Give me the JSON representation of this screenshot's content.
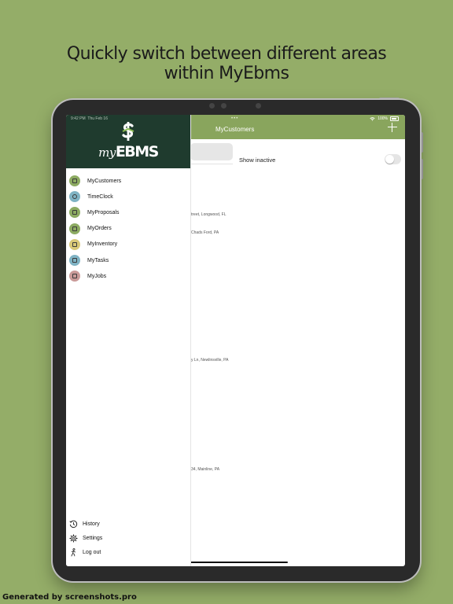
{
  "headline": {
    "line1": "Quickly switch between different areas",
    "line2": "within MyEbms"
  },
  "footer_credit": "Generated by screenshots.pro",
  "status_bar": {
    "time": "9:42 PM",
    "date": "Thu Feb 16",
    "battery": "100%"
  },
  "nav": {
    "dots": "•••",
    "title": "MyCustomers",
    "add_icon": "plus-icon"
  },
  "filter": {
    "show_inactive_label": "Show inactive",
    "show_inactive_on": false
  },
  "customer_addresses": [
    "treet, Longwood, FL",
    "Chads Ford, PA",
    "y Ln, Newlinsville, PA",
    "34, Mainline, PA"
  ],
  "brand": {
    "logo_my": "my",
    "logo_ebms": "EBMS",
    "sidebar_header_color": "#1f3b2e",
    "nav_color": "#89a55d"
  },
  "menu": [
    {
      "label": "MyCustomers",
      "icon": "customers-icon",
      "color": "#8dab62"
    },
    {
      "label": "TimeClock",
      "icon": "clock-icon",
      "color": "#7fb3c4"
    },
    {
      "label": "MyProposals",
      "icon": "proposal-icon",
      "color": "#8dab62"
    },
    {
      "label": "MyOrders",
      "icon": "orders-icon",
      "color": "#8dab62"
    },
    {
      "label": "MyInventory",
      "icon": "inventory-icon",
      "color": "#d9c878"
    },
    {
      "label": "MyTasks",
      "icon": "tasks-icon",
      "color": "#7fb3c4"
    },
    {
      "label": "MyJobs",
      "icon": "jobs-icon",
      "color": "#c99a98"
    }
  ],
  "bottom_menu": [
    {
      "label": "History",
      "icon": "history-icon"
    },
    {
      "label": "Settings",
      "icon": "gear-icon"
    },
    {
      "label": "Log out",
      "icon": "logout-icon"
    }
  ]
}
